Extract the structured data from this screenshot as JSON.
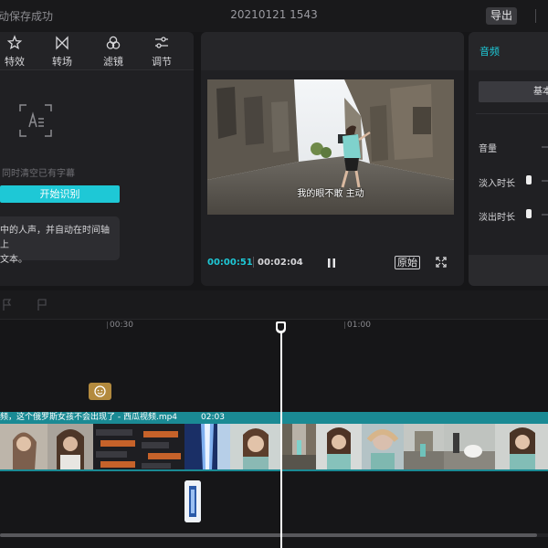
{
  "topbar": {
    "save_status": "动保存成功",
    "project_name": "20210121 1543",
    "export_label": "导出"
  },
  "tools": [
    {
      "label": "特效",
      "icon": "effects-icon"
    },
    {
      "label": "转场",
      "icon": "transition-icon"
    },
    {
      "label": "滤镜",
      "icon": "filter-icon"
    },
    {
      "label": "调节",
      "icon": "adjust-icon"
    }
  ],
  "captions": {
    "note": "同时清空已有字幕",
    "start_button": "开始识别",
    "tip_line1": "中的人声，并自动在时间轴上",
    "tip_line2": "文本。"
  },
  "player": {
    "subtitle": "我的眼不敢 主动",
    "current_time": "00:00:51",
    "total_time": "00:02:04",
    "original_label": "原始"
  },
  "audio_panel": {
    "tab": "音频",
    "basic_button": "基本",
    "volume_label": "音量",
    "fade_in_label": "淡入时长",
    "fade_out_label": "淡出时长"
  },
  "timeline": {
    "ruler_label_1": "00:30",
    "ruler_label_2": "01:00",
    "clip_title": "频，这个俄罗斯女孩不会出现了 - 西瓜视频.mp4",
    "clip_duration": "02:03"
  },
  "colors": {
    "accent": "#1ec8d6",
    "clip_track": "#1a8a94",
    "sticker": "#b38a3e"
  }
}
